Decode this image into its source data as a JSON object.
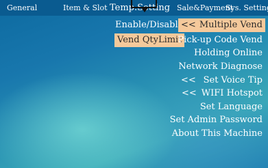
{
  "tabs": [
    {
      "label": "General"
    },
    {
      "label": "Item & Slot"
    },
    {
      "label": "Temp.Setting"
    },
    {
      "label": "Sale&Payment"
    },
    {
      "label": "Sys. Setting"
    }
  ],
  "left_options": [
    {
      "label": "Enable/Disable"
    },
    {
      "label": "Vend QtyLimit"
    }
  ],
  "menu": {
    "arrow": "<<",
    "items": [
      {
        "label": "Multiple Vend"
      },
      {
        "label": "Pick-up Code Vend"
      },
      {
        "label": "Holding Online"
      },
      {
        "label": "Network Diagnose"
      },
      {
        "label": "Set Voice Tip"
      },
      {
        "label": "WIFI Hotspot"
      },
      {
        "label": "Set Language"
      },
      {
        "label": "Set Admin Password"
      },
      {
        "label": "About This Machine"
      }
    ]
  },
  "colors": {
    "tab_bar": "#0a5b90",
    "highlight": "#f5c99b",
    "background_top": "#0d6aa0",
    "background_accent": "#3aa9b7"
  }
}
